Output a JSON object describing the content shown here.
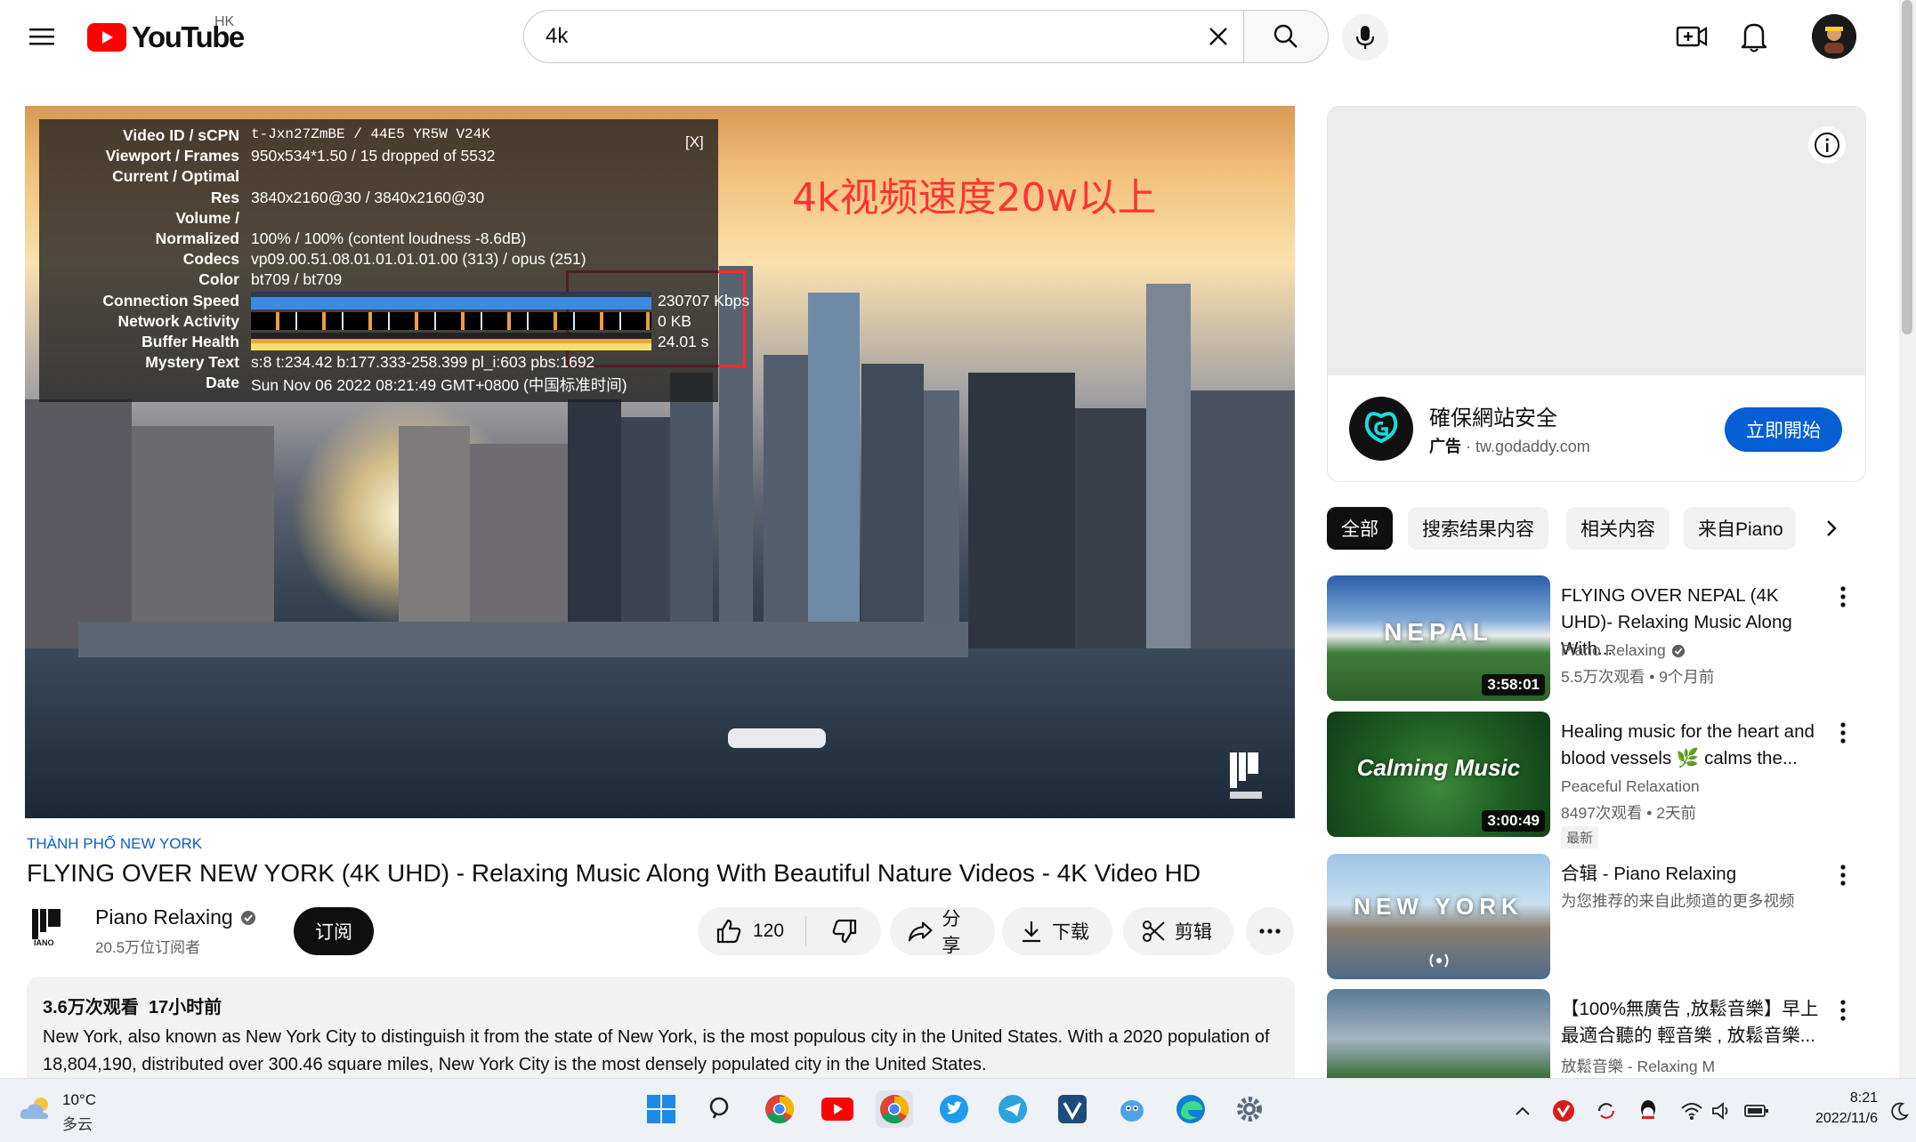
{
  "header": {
    "logo_text": "YouTube",
    "region": "HK",
    "search_value": "4k"
  },
  "video": {
    "overlay_text": "4k视频速度20w以上",
    "stats": {
      "close_label": "[X]",
      "rows": [
        {
          "label": "Video ID / sCPN",
          "value": "t-Jxn27ZmBE / 44E5 YR5W V24K"
        },
        {
          "label": "Viewport / Frames",
          "value": "950x534*1.50 / 15 dropped of 5532"
        },
        {
          "label": "Current / Optimal",
          "value": ""
        },
        {
          "label": "Res",
          "value": "3840x2160@30 / 3840x2160@30"
        },
        {
          "label": "Volume /",
          "value": ""
        },
        {
          "label": "Normalized",
          "value": "100% / 100% (content loudness -8.6dB)"
        },
        {
          "label": "Codecs",
          "value": "vp09.00.51.08.01.01.01.01.00 (313) / opus (251)"
        },
        {
          "label": "Color",
          "value": "bt709 / bt709"
        },
        {
          "label": "Connection Speed",
          "value": "230707 Kbps"
        },
        {
          "label": "Network Activity",
          "value": "0 KB"
        },
        {
          "label": "Buffer Health",
          "value": "24.01 s"
        },
        {
          "label": "Mystery Text",
          "value": "s:8 t:234.42 b:177.333-258.399 pl_i:603 pbs:1692"
        },
        {
          "label": "Date",
          "value": "Sun Nov 06 2022 08:21:49 GMT+0800 (中国标准时间)"
        }
      ]
    },
    "hashtag": "THÀNH PHỐ NEW YORK",
    "title": "FLYING OVER NEW YORK (4K UHD) - Relaxing Music Along With Beautiful Nature Videos - 4K Video HD",
    "channel": {
      "name": "Piano Relaxing",
      "subscribers": "20.5万位订阅者",
      "subscribe_label": "订阅"
    },
    "actions": {
      "like_count": "120",
      "share_label": "分享",
      "download_label": "下载",
      "clip_label": "剪辑"
    },
    "description": {
      "views": "3.6万次观看",
      "time_ago": "17小时前",
      "text": "New York, also known as New York City to distinguish it from the state of New York, is the most populous city in the United States. With a 2020 population of 18,804,190, distributed over 300.46 square miles, New York City is the most densely populated city in the United States."
    }
  },
  "ad": {
    "title": "確保網站安全",
    "ad_label": "广告",
    "domain": "tw.godaddy.com",
    "cta": "立即開始"
  },
  "chips": [
    "全部",
    "搜索结果内容",
    "相关内容",
    "来自Piano"
  ],
  "recommendations": [
    {
      "thumb_text": "NEPAL",
      "duration": "3:58:01",
      "title": "FLYING OVER NEPAL (4K UHD)- Relaxing Music Along With...",
      "channel": "Piano Relaxing",
      "meta": "5.5万次观看 • 9个月前",
      "badge": ""
    },
    {
      "thumb_text": "Calming Music",
      "duration": "3:00:49",
      "title": "Healing music for the heart and blood vessels 🌿 calms the...",
      "channel": "Peaceful Relaxation",
      "meta": "8497次观看 • 2天前",
      "badge": "最新"
    },
    {
      "thumb_text": "NEW YORK",
      "duration": "",
      "title": "合辑 - Piano Relaxing",
      "channel": "为您推荐的来自此频道的更多视频",
      "meta": "",
      "badge": ""
    },
    {
      "thumb_text": "",
      "duration": "",
      "title": "【100%無廣告 ,放鬆音樂】早上最適合聽的 輕音樂 , 放鬆音樂...",
      "channel": "放鬆音樂 - Relaxing M",
      "meta": "",
      "badge": ""
    }
  ],
  "taskbar": {
    "weather_temp": "10°C",
    "weather_desc": "多云",
    "time": "8:21",
    "date": "2022/11/6"
  }
}
